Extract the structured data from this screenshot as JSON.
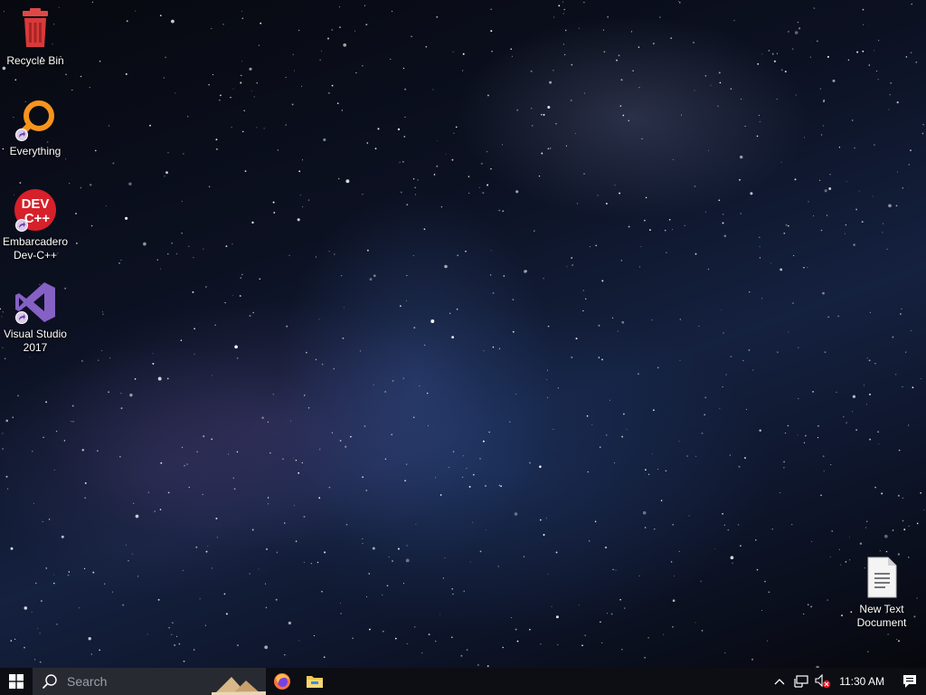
{
  "desktop": {
    "icons": [
      {
        "label": "Recycle Bin",
        "icon": "recycle-bin-icon"
      },
      {
        "label": "Everything",
        "icon": "everything-search-icon"
      },
      {
        "label": "Embarcadero Dev-C++",
        "icon": "devcpp-icon",
        "badge_text": "DEV C++"
      },
      {
        "label": "Visual Studio 2017",
        "icon": "visual-studio-icon"
      },
      {
        "label": "New Text Document",
        "icon": "text-document-icon"
      }
    ]
  },
  "taskbar": {
    "start_icon": "windows-logo-icon",
    "search_placeholder": "Search",
    "pinned": [
      {
        "name": "Firefox",
        "icon": "firefox-icon"
      },
      {
        "name": "File Explorer",
        "icon": "folder-icon"
      }
    ],
    "tray": {
      "icons": [
        "chevron-up-icon",
        "network-icon",
        "volume-muted-icon"
      ],
      "time": "11:30 AM"
    },
    "notification_icon": "notification-icon"
  }
}
